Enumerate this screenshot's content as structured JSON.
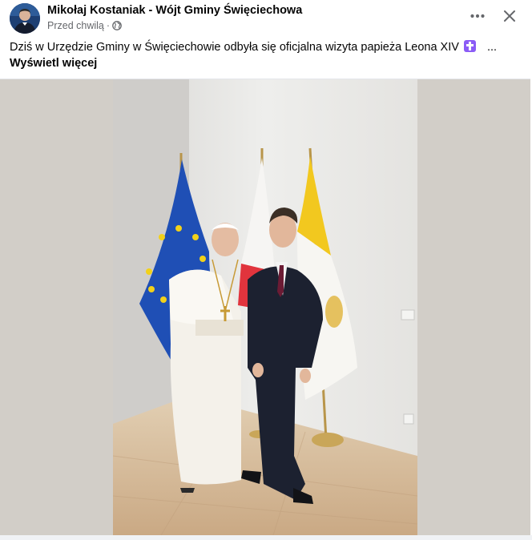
{
  "post": {
    "author": "Mikołaj Kostaniak - Wójt Gminy Święciechowa",
    "timestamp": "Przed chwilą",
    "separator": "·",
    "text": "Dziś w Urzędzie Gminy w Święciechowie odbyła się oficjalna wizyta papieża Leona XIV",
    "ellipsis": "...",
    "see_more": "Wyświetl więcej"
  },
  "icons": {
    "more": "more-horizontal-icon",
    "close": "close-icon",
    "audience": "globe-icon",
    "emoji": "latin-cross-emoji"
  },
  "colors": {
    "text": "#050505",
    "secondary": "#65676b",
    "emoji_bg": "#8b5cf6"
  }
}
